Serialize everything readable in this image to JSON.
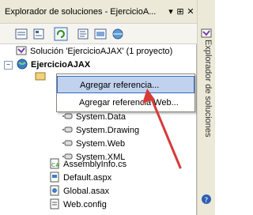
{
  "panel": {
    "title": "Explorador de soluciones - EjercicioA...",
    "title_buttons": [
      "▾",
      "⊞",
      "✕"
    ]
  },
  "toolbar": {
    "buttons": [
      "properties-icon",
      "show-all-files-icon",
      "refresh-icon",
      "view-code-icon",
      "view-designer-icon",
      "copy-website-icon"
    ]
  },
  "tree": {
    "solution": "Solución 'EjercicioAJAX' (1 proyecto)",
    "project": "EjercicioAJAX",
    "references_folder": "",
    "references": [
      "System.Data",
      "System.Drawing",
      "System.Web",
      "System.XML"
    ],
    "files": [
      "AssemblyInfo.cs",
      "Default.aspx",
      "Global.asax",
      "Web.config"
    ]
  },
  "context_menu": {
    "items": [
      "Agregar referencia...",
      "Agregar referencia Web..."
    ],
    "selected_index": 0
  },
  "side_panel": {
    "vertical_label": "Explorador de soluciones"
  },
  "colors": {
    "highlight": "#c1d2ee",
    "highlight_border": "#316ac5",
    "arrow": "#d83a3a"
  }
}
